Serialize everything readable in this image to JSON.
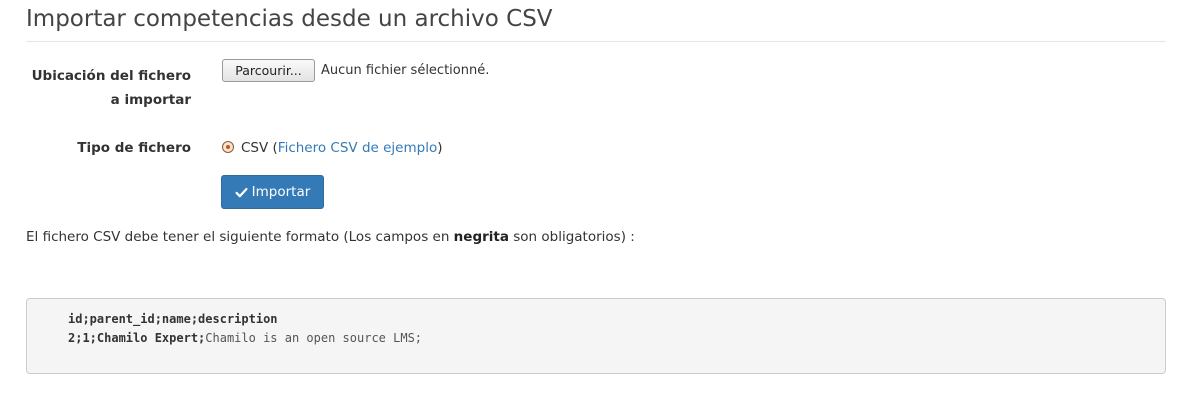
{
  "page": {
    "title": "Importar competencias desde un archivo CSV"
  },
  "form": {
    "file_label": "Ubicación del fichero a importar",
    "file_button_label": "Parcourir...",
    "file_status": "Aucun fichier sélectionné.",
    "type_label": "Tipo de fichero",
    "type_option_label": "CSV",
    "type_open_paren": " (",
    "type_example_link": "Fichero CSV de ejemplo",
    "type_close_paren": ")",
    "type_option_selected": true,
    "submit_icon": "check-icon",
    "submit_label": "Importar"
  },
  "help": {
    "text_before": "El fichero CSV debe tener el siguiente formato (Los campos en ",
    "bold_word": "negrita",
    "text_after": " son obligatorios) :"
  },
  "code_example": {
    "header_line": "id;parent_id;name;description",
    "row_required": "2;1;Chamilo Expert;",
    "row_optional": "Chamilo is an open source LMS;"
  },
  "colors": {
    "primary": "#337ab7",
    "link": "#337ab7",
    "code_background": "#f5f5f5"
  }
}
